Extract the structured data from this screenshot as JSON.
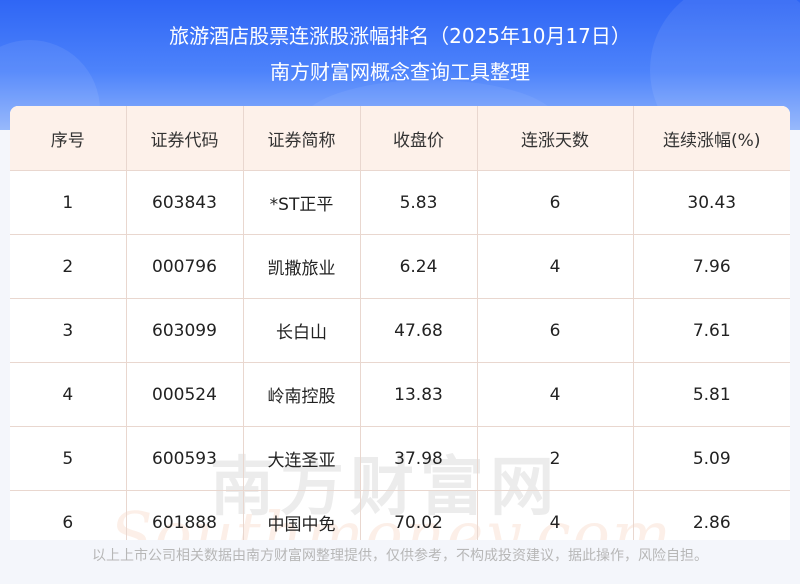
{
  "header": {
    "title": "旅游酒店股票连涨股涨幅排名（2025年10月17日）",
    "subtitle": "南方财富网概念查询工具整理"
  },
  "table": {
    "columns": [
      "序号",
      "证券代码",
      "证券简称",
      "收盘价",
      "连涨天数",
      "连续涨幅(%)"
    ],
    "rows": [
      [
        "1",
        "603843",
        "*ST正平",
        "5.83",
        "6",
        "30.43"
      ],
      [
        "2",
        "000796",
        "凯撒旅业",
        "6.24",
        "4",
        "7.96"
      ],
      [
        "3",
        "603099",
        "长白山",
        "47.68",
        "6",
        "7.61"
      ],
      [
        "4",
        "000524",
        "岭南控股",
        "13.83",
        "4",
        "5.81"
      ],
      [
        "5",
        "600593",
        "大连圣亚",
        "37.98",
        "2",
        "5.09"
      ],
      [
        "6",
        "601888",
        "中国中免",
        "70.02",
        "4",
        "2.86"
      ]
    ]
  },
  "watermark": {
    "cn": "南方财富网",
    "en": "Southmoney.com"
  },
  "footer": {
    "disclaimer": "以上上市公司相关数据由南方财富网整理提供，仅供参考，不构成投资建议，据此操作，风险自担。"
  },
  "colors": {
    "banner": "#2f66f5",
    "header_bg": "#fdf1ea",
    "grid": "#e9d7cf"
  }
}
